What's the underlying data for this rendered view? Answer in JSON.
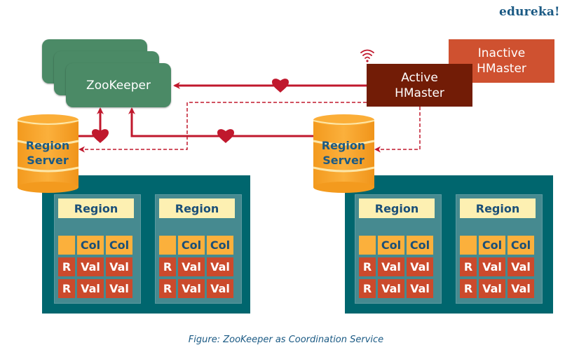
{
  "brand": {
    "logo": "edureka!"
  },
  "colors": {
    "zookeeper": "#4b8a66",
    "active_hmaster": "#721c06",
    "inactive_hmaster": "#cf5130",
    "region_server": "#f9a530",
    "panel": "#00666e",
    "region_title": "#fdf0b2",
    "col_cell": "#fbb03c",
    "val_cell": "#cb4a2c",
    "connector": "#c0182d"
  },
  "zookeeper": {
    "label": "ZooKeeper",
    "instances": 3
  },
  "hmasters": {
    "active": {
      "line1": "Active",
      "line2": "HMaster",
      "icon": "wifi-signal-icon"
    },
    "inactive": {
      "line1": "Inactive",
      "line2": "HMaster"
    }
  },
  "region_servers": [
    {
      "line1": "Region",
      "line2": "Server",
      "regions": [
        {
          "title": "Region",
          "header": [
            "",
            "Col",
            "Col"
          ],
          "rows": [
            [
              "R",
              "Val",
              "Val"
            ],
            [
              "R",
              "Val",
              "Val"
            ]
          ]
        },
        {
          "title": "Region",
          "header": [
            "",
            "Col",
            "Col"
          ],
          "rows": [
            [
              "R",
              "Val",
              "Val"
            ],
            [
              "R",
              "Val",
              "Val"
            ]
          ]
        }
      ]
    },
    {
      "line1": "Region",
      "line2": "Server",
      "regions": [
        {
          "title": "Region",
          "header": [
            "",
            "Col",
            "Col"
          ],
          "rows": [
            [
              "R",
              "Val",
              "Val"
            ],
            [
              "R",
              "Val",
              "Val"
            ]
          ]
        },
        {
          "title": "Region",
          "header": [
            "",
            "Col",
            "Col"
          ],
          "rows": [
            [
              "R",
              "Val",
              "Val"
            ],
            [
              "R",
              "Val",
              "Val"
            ]
          ]
        }
      ]
    }
  ],
  "connections": [
    {
      "from": "Active HMaster",
      "to": "ZooKeeper",
      "style": "solid",
      "marker": "heartbeat-icon"
    },
    {
      "from": "Region Server 1",
      "to": "ZooKeeper",
      "style": "solid",
      "marker": "heartbeat-icon"
    },
    {
      "from": "Region Server 2",
      "to": "ZooKeeper",
      "style": "solid",
      "marker": "heartbeat-icon"
    },
    {
      "from": "Active HMaster",
      "to": "Region Server 1",
      "style": "dashed"
    },
    {
      "from": "Active HMaster",
      "to": "Region Server 2",
      "style": "dashed"
    }
  ],
  "caption": "Figure: ZooKeeper as Coordination Service"
}
